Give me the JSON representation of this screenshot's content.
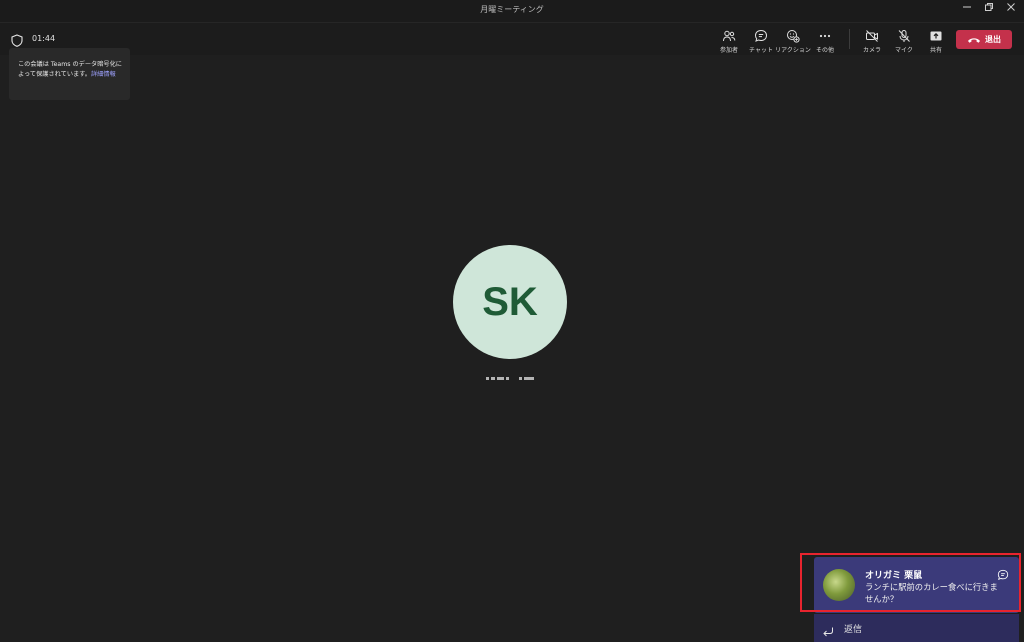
{
  "window": {
    "title": "月曜ミーティング"
  },
  "meeting": {
    "timer": "01:44"
  },
  "toolbar": {
    "participants": "参加者",
    "chat": "チャット",
    "reactions": "リアクション",
    "more": "その他",
    "camera": "カメラ",
    "mic": "マイク",
    "share": "共有",
    "leave": "退出"
  },
  "info": {
    "text": "この会議は Teams のデータ暗号化によって保護されています。",
    "link": "詳細情報"
  },
  "participant": {
    "initials": "SK"
  },
  "notification": {
    "sender": "オリガミ 栗鼠",
    "message": "ランチに駅前のカレー食べに行きませんか？",
    "reply": "返信"
  },
  "colors": {
    "background": "#1f1f1f",
    "leave_button": "#c4314b",
    "avatar_bg": "#cfe6d9",
    "avatar_text": "#1f5b36",
    "notification_bg": "#3b3a7a",
    "highlight": "#e8242e",
    "link": "#9ea2ff"
  },
  "icons": [
    "shield-icon",
    "participants-icon",
    "chat-icon",
    "reactions-icon",
    "more-icon",
    "camera-off-icon",
    "mic-off-icon",
    "share-icon",
    "hangup-icon",
    "reply-icon"
  ]
}
